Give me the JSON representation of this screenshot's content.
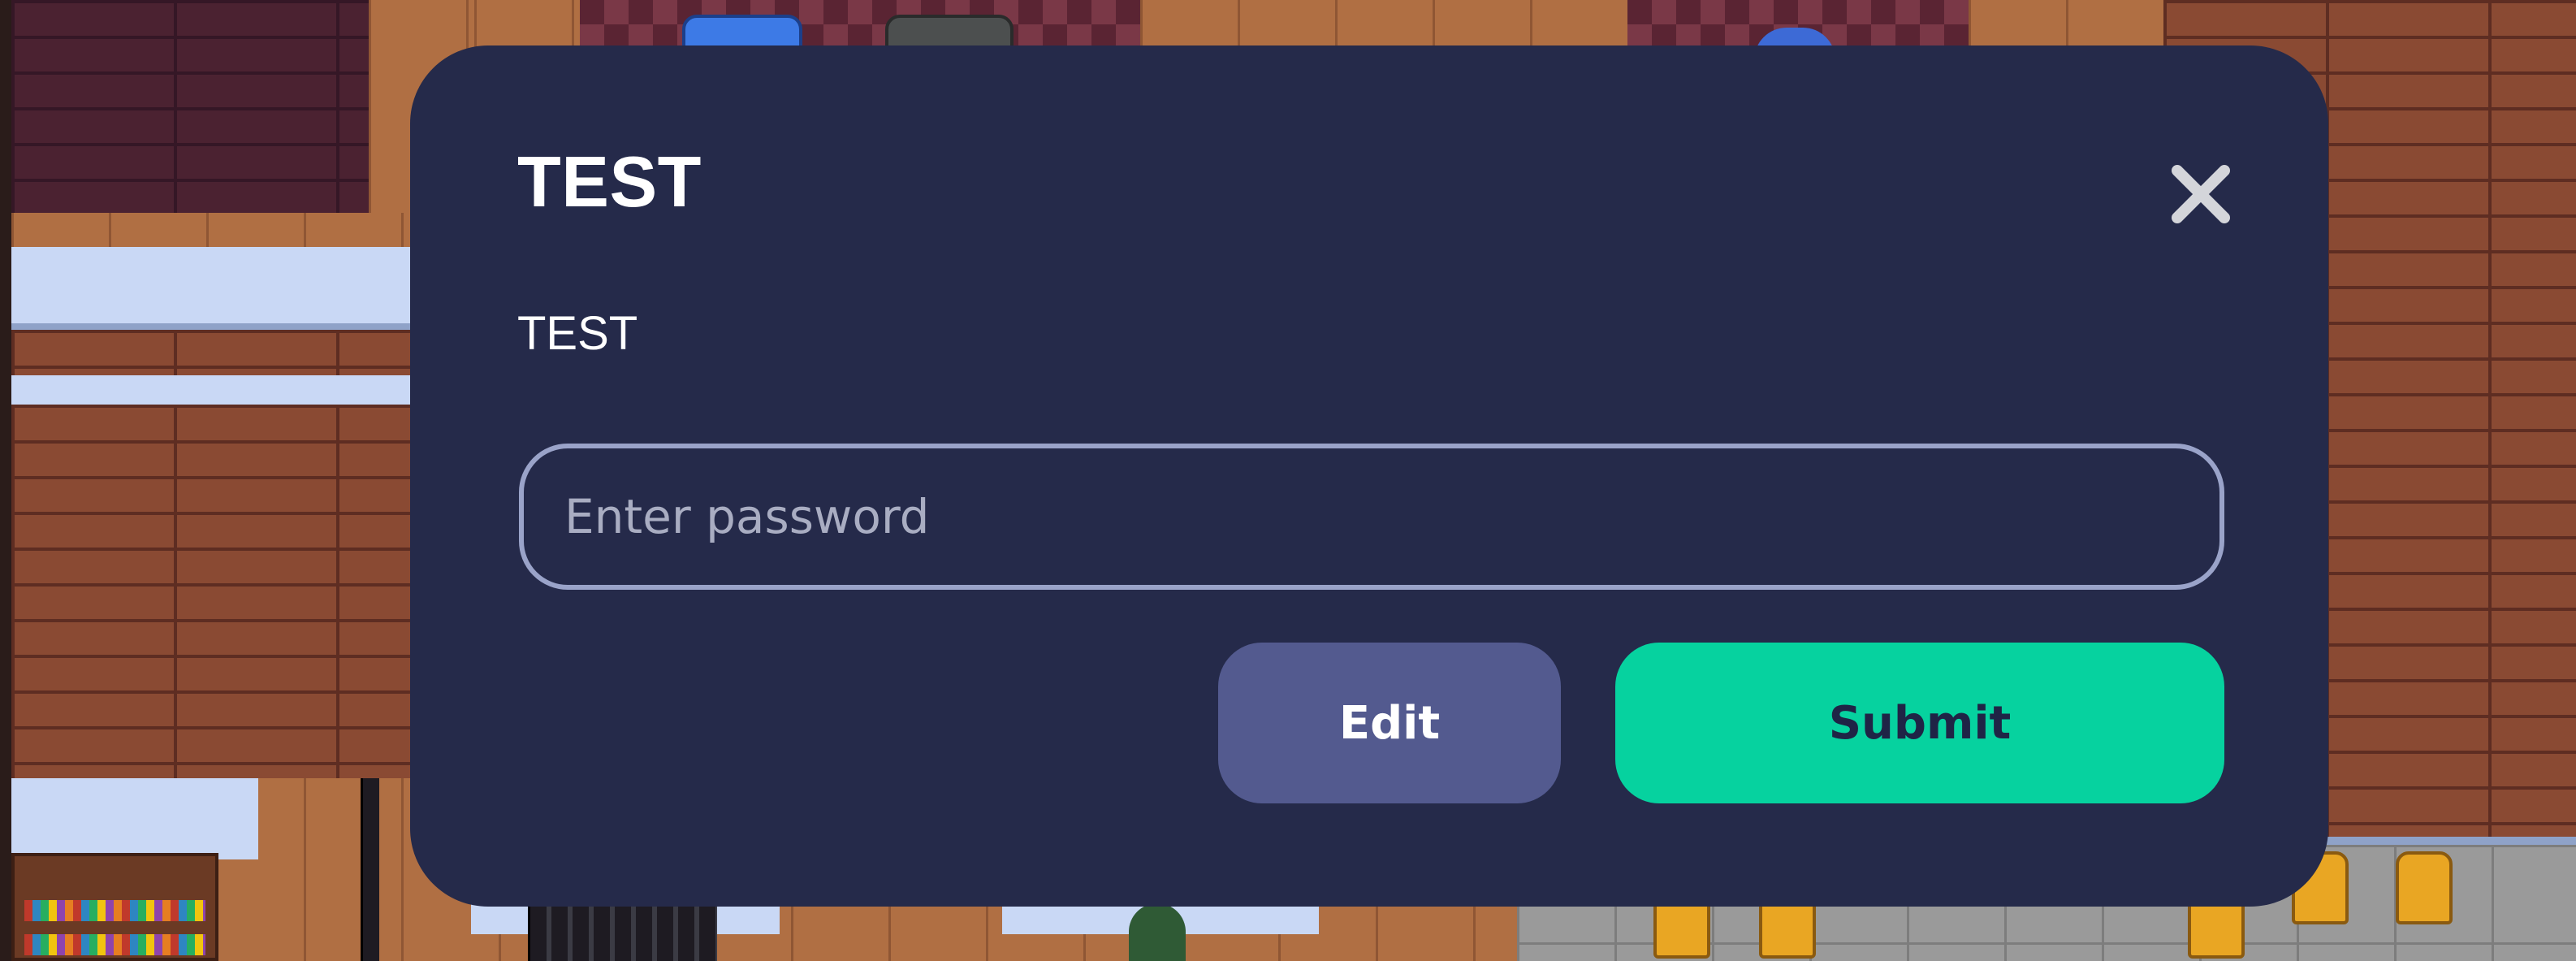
{
  "modal": {
    "title": "TEST",
    "message": "TEST",
    "password_placeholder": "Enter password",
    "password_value": "",
    "edit_label": "Edit",
    "submit_label": "Submit",
    "close_icon": "close-icon"
  },
  "colors": {
    "modal_background": "#252a4a",
    "input_border": "#9aa3c9",
    "edit_button": "#535a8f",
    "submit_button": "#06d29f",
    "submit_text": "#1f2446",
    "title_text": "#ffffff"
  }
}
